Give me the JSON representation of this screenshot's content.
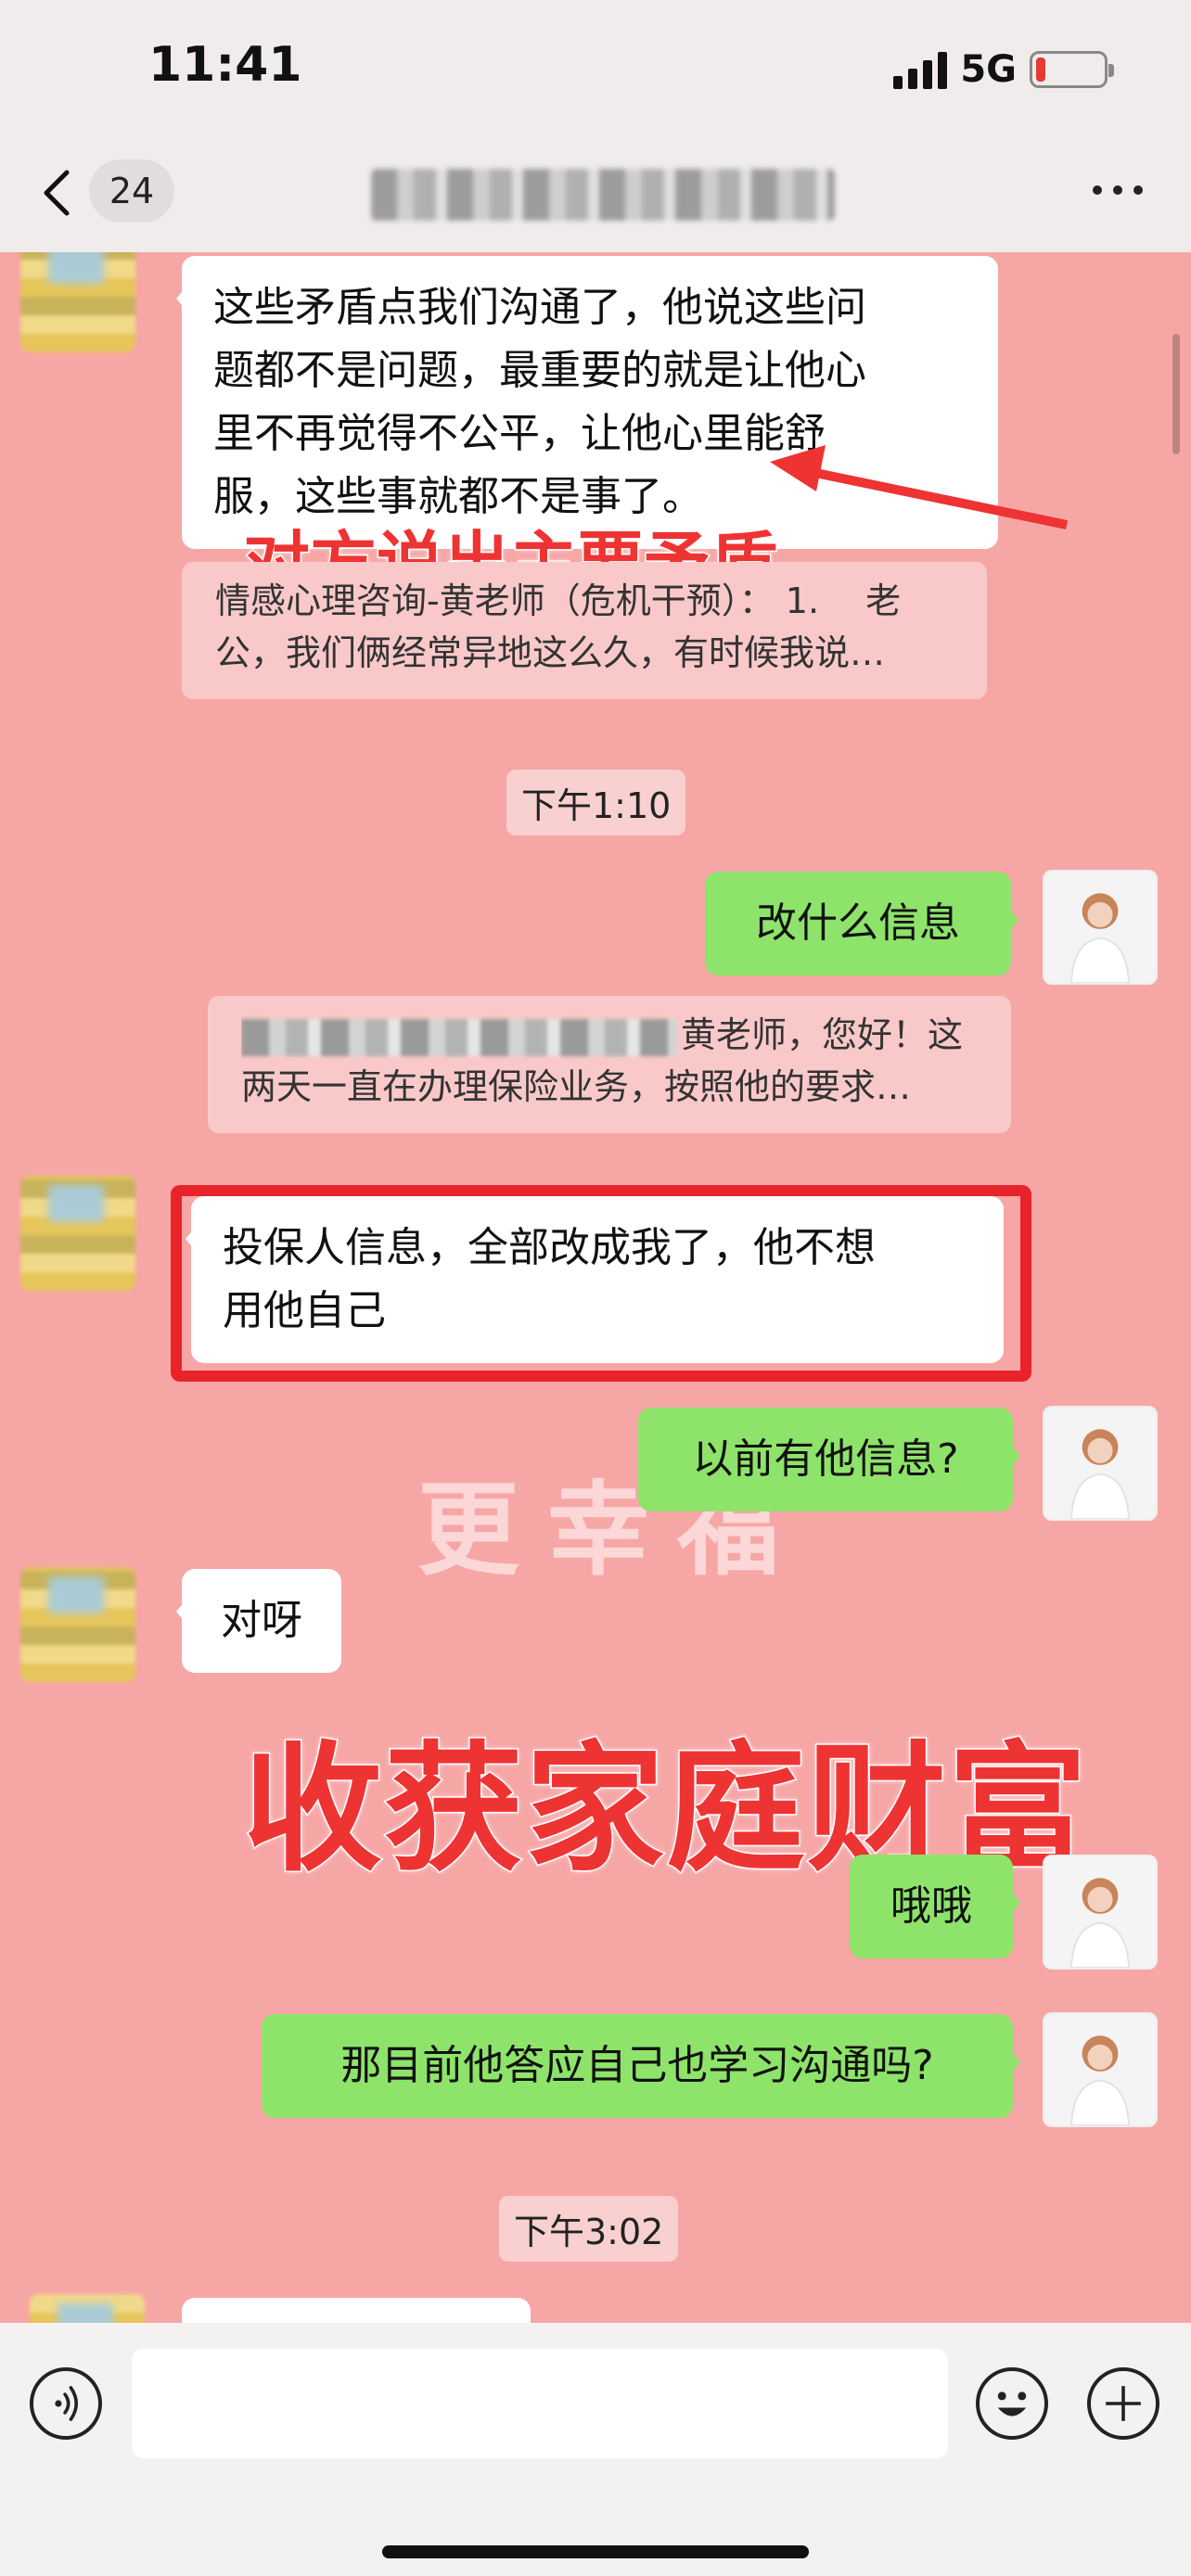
{
  "status": {
    "time": "11:41",
    "network": "5G"
  },
  "nav": {
    "unread_count": "24"
  },
  "messages": {
    "m1": {
      "lines": [
        "这些矛盾点我们沟通了，他说这些问",
        "题都不是问题，最重要的就是让他心",
        "里不再觉得不公平，让他心里能舒",
        "服，这些事就都不是事了。"
      ]
    },
    "q1": {
      "line1": "情感心理咨询-黄老师（危机干预）： 1.　 老",
      "line2": "公，我们俩经常异地这么久，有时候我说…"
    },
    "ts1": "下午1:10",
    "m2": "改什么信息",
    "q2": {
      "line1_tail": "黄老师，您好！这",
      "line2": "两天一直在办理保险业务，按照他的要求…"
    },
    "m3": {
      "lines": [
        "投保人信息，全部改成我了，他不想",
        "用他自己"
      ]
    },
    "m4": "以前有他信息?",
    "m5": "对呀",
    "m6": "哦哦",
    "m7": "那目前他答应自己也学习沟通吗?",
    "ts2": "下午3:02"
  },
  "annotations": {
    "caption1": "对方说出主要矛盾",
    "caption2": "收获家庭财富",
    "watermark_line1": "更幸福"
  },
  "colors": {
    "chat_bg": "#F7A6A6",
    "bubble_me": "#8EE46A",
    "annotation_red": "#E8242A"
  }
}
